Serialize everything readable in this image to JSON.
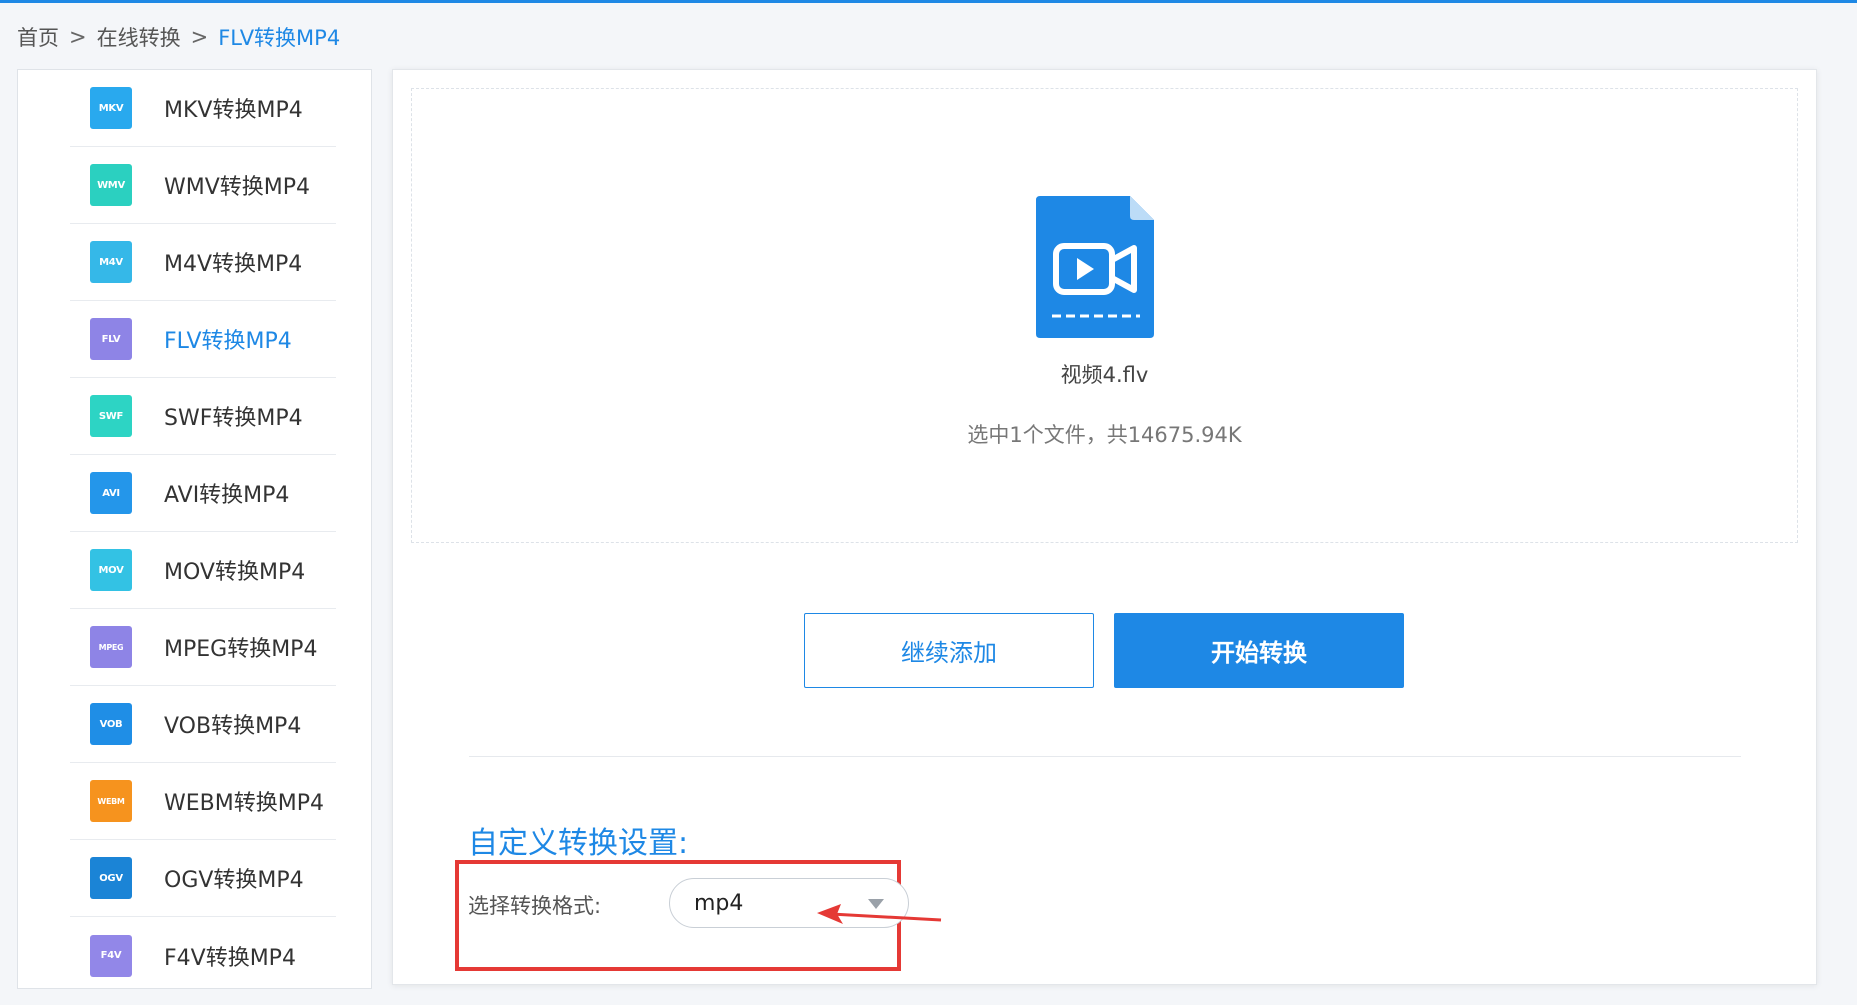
{
  "breadcrumb": {
    "home": "首页",
    "sep1": ">",
    "section": "在线转换",
    "sep2": ">",
    "current": "FLV转换MP4"
  },
  "sidebar": {
    "items": [
      {
        "badge": "MKV",
        "label": "MKV转换MP4",
        "color": "#29a9ee",
        "active": false
      },
      {
        "badge": "WMV",
        "label": "WMV转换MP4",
        "color": "#2bd0c0",
        "active": false
      },
      {
        "badge": "M4V",
        "label": "M4V转换MP4",
        "color": "#35b8e8",
        "active": false
      },
      {
        "badge": "FLV",
        "label": "FLV转换MP4",
        "color": "#8e84e6",
        "active": true
      },
      {
        "badge": "SWF",
        "label": "SWF转换MP4",
        "color": "#2dd4c4",
        "active": false
      },
      {
        "badge": "AVI",
        "label": "AVI转换MP4",
        "color": "#2496ea",
        "active": false
      },
      {
        "badge": "MOV",
        "label": "MOV转换MP4",
        "color": "#33c2e4",
        "active": false
      },
      {
        "badge": "MPEG",
        "label": "MPEG转换MP4",
        "color": "#8e84e6",
        "active": false
      },
      {
        "badge": "VOB",
        "label": "VOB转换MP4",
        "color": "#1f8ee6",
        "active": false
      },
      {
        "badge": "WEBM",
        "label": "WEBM转换MP4",
        "color": "#f6931e",
        "active": false
      },
      {
        "badge": "OGV",
        "label": "OGV转换MP4",
        "color": "#1b84d6",
        "active": false
      },
      {
        "badge": "F4V",
        "label": "F4V转换MP4",
        "color": "#9287e8",
        "active": false
      }
    ]
  },
  "upload": {
    "file_icon": "video-file-icon",
    "file_name": "视频4.flv",
    "file_info": "选中1个文件，共14675.94K"
  },
  "actions": {
    "add_more": "继续添加",
    "start": "开始转换"
  },
  "settings": {
    "title": "自定义转换设置:",
    "format_label": "选择转换格式:",
    "format_value": "mp4"
  },
  "colors": {
    "accent": "#1e88e5",
    "highlight": "#e53935"
  }
}
